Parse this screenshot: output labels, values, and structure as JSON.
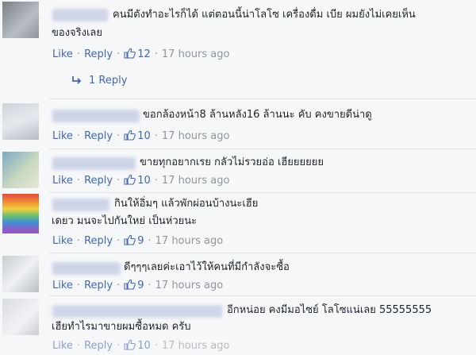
{
  "actions": {
    "like": "Like",
    "reply": "Reply",
    "dot": "·",
    "time": "17 hours ago"
  },
  "comments": [
    {
      "text_line1": "คนมีตังทำอะไรก็ได้ แต่ตอนนี้น่าโลโซ เครื่องดื่ม เบีย ผมยังไม่เคยเห็น",
      "text_line2": "ของจริงเลย",
      "likes": "12",
      "replies_link": "1 Reply"
    },
    {
      "text_line1": "ขอกล้องหน้า8 ล้านหลัง16 ล้านนะ คับ คงขายดีน่าดู",
      "likes": "10"
    },
    {
      "text_line1": "ขายทุกอยากเรย กลัวไม่รวยอ่อ เฮียยยยยย",
      "likes": "10"
    },
    {
      "text_line1": "กินให้อิ่มๆ แล้วพักผ่อนบ้างนะเฮีย",
      "text_line2": "เดยว มนจะไปกันใหย่ เป็นห่วยนะ",
      "likes": "9"
    },
    {
      "text_line1": "ดีๆๆๆเลยค่ะเอาไว้ให้คนที่มีกำลังจะซื้อ",
      "likes": "9"
    },
    {
      "text_line1": "อีกหน่อย คงมีมอไซย์ โลโซแน่เลย 55555555",
      "text_line2": "เฮียทำไรมาขายผมซื้อหมด ครับ",
      "likes": "10"
    }
  ],
  "colors": {
    "link": "#4267b2",
    "meta": "#90949c",
    "text": "#1d2129",
    "background": "#f6f7f9"
  }
}
